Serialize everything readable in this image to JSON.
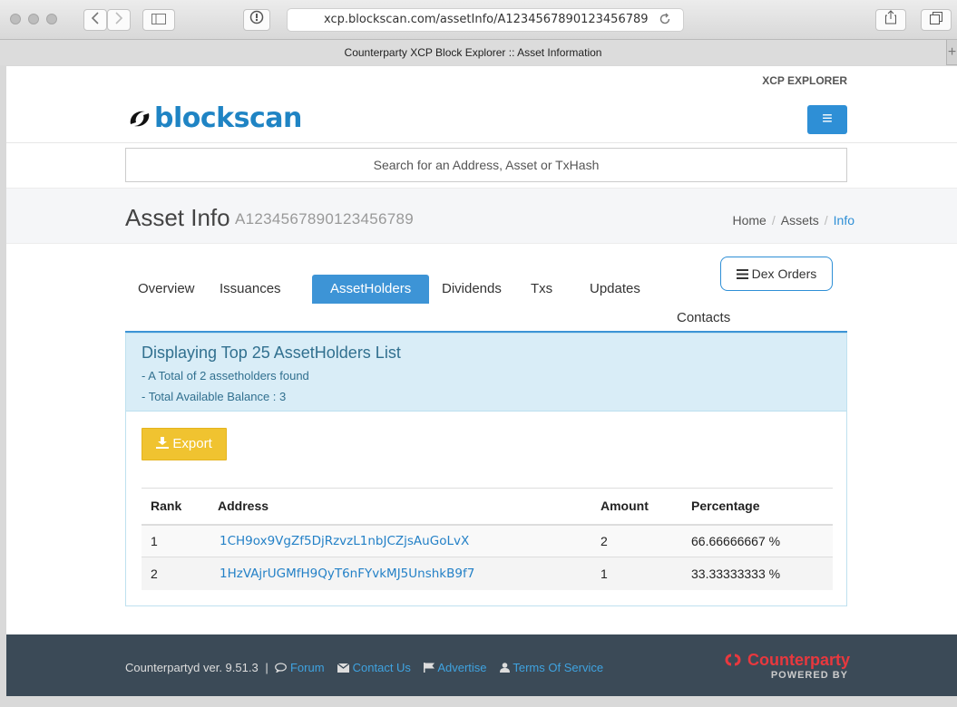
{
  "browser": {
    "url": "xcp.blockscan.com/assetInfo/A1234567890123456789",
    "tab_title": "Counterparty XCP Block Explorer :: Asset Information",
    "new_tab_symbol": "+"
  },
  "header": {
    "xcp_link": "XCP EXPLORER",
    "logo_text": "blockscan",
    "menu_symbol": "≡"
  },
  "search": {
    "placeholder": "Search for an Address, Asset or TxHash"
  },
  "title": {
    "main": "Asset Info",
    "sub": "A1234567890123456789"
  },
  "breadcrumb": {
    "home": "Home",
    "assets": "Assets",
    "info": "Info",
    "separator": "/"
  },
  "tabs": {
    "overview": "Overview",
    "issuances": "Issuances",
    "assetholders": "AssetHolders",
    "dividends": "Dividends",
    "txs": "Txs",
    "updates": "Updates",
    "contacts": "Contacts",
    "dex_orders": "Dex Orders"
  },
  "panel": {
    "title": "Displaying Top 25 AssetHolders List",
    "line1": "- A Total of 2 assetholders found",
    "line2": "- Total Available Balance : 3",
    "export": "Export"
  },
  "table": {
    "headers": {
      "rank": "Rank",
      "address": "Address",
      "amount": "Amount",
      "percentage": "Percentage"
    },
    "rows": [
      {
        "rank": "1",
        "address": "1CH9ox9VgZf5DjRzvzL1nbJCZjsAuGoLvX",
        "amount": "2",
        "percentage": "66.66666667 %"
      },
      {
        "rank": "2",
        "address": "1HzVAjrUGMfH9QyT6nFYvkMJ5UnshkB9f7",
        "amount": "1",
        "percentage": "33.33333333 %"
      }
    ]
  },
  "footer": {
    "version": "Counterpartyd ver. 9.51.3",
    "separator": "|",
    "forum": "Forum",
    "contact": "Contact Us",
    "advertise": "Advertise",
    "terms": "Terms Of Service",
    "brand": "Counterparty",
    "powered": "POWERED BY"
  },
  "colors": {
    "accent": "#3d94d6",
    "link": "#2481c7",
    "export": "#f0c330",
    "footer_bg": "#3b4a57",
    "brand_red": "#e8383e"
  }
}
